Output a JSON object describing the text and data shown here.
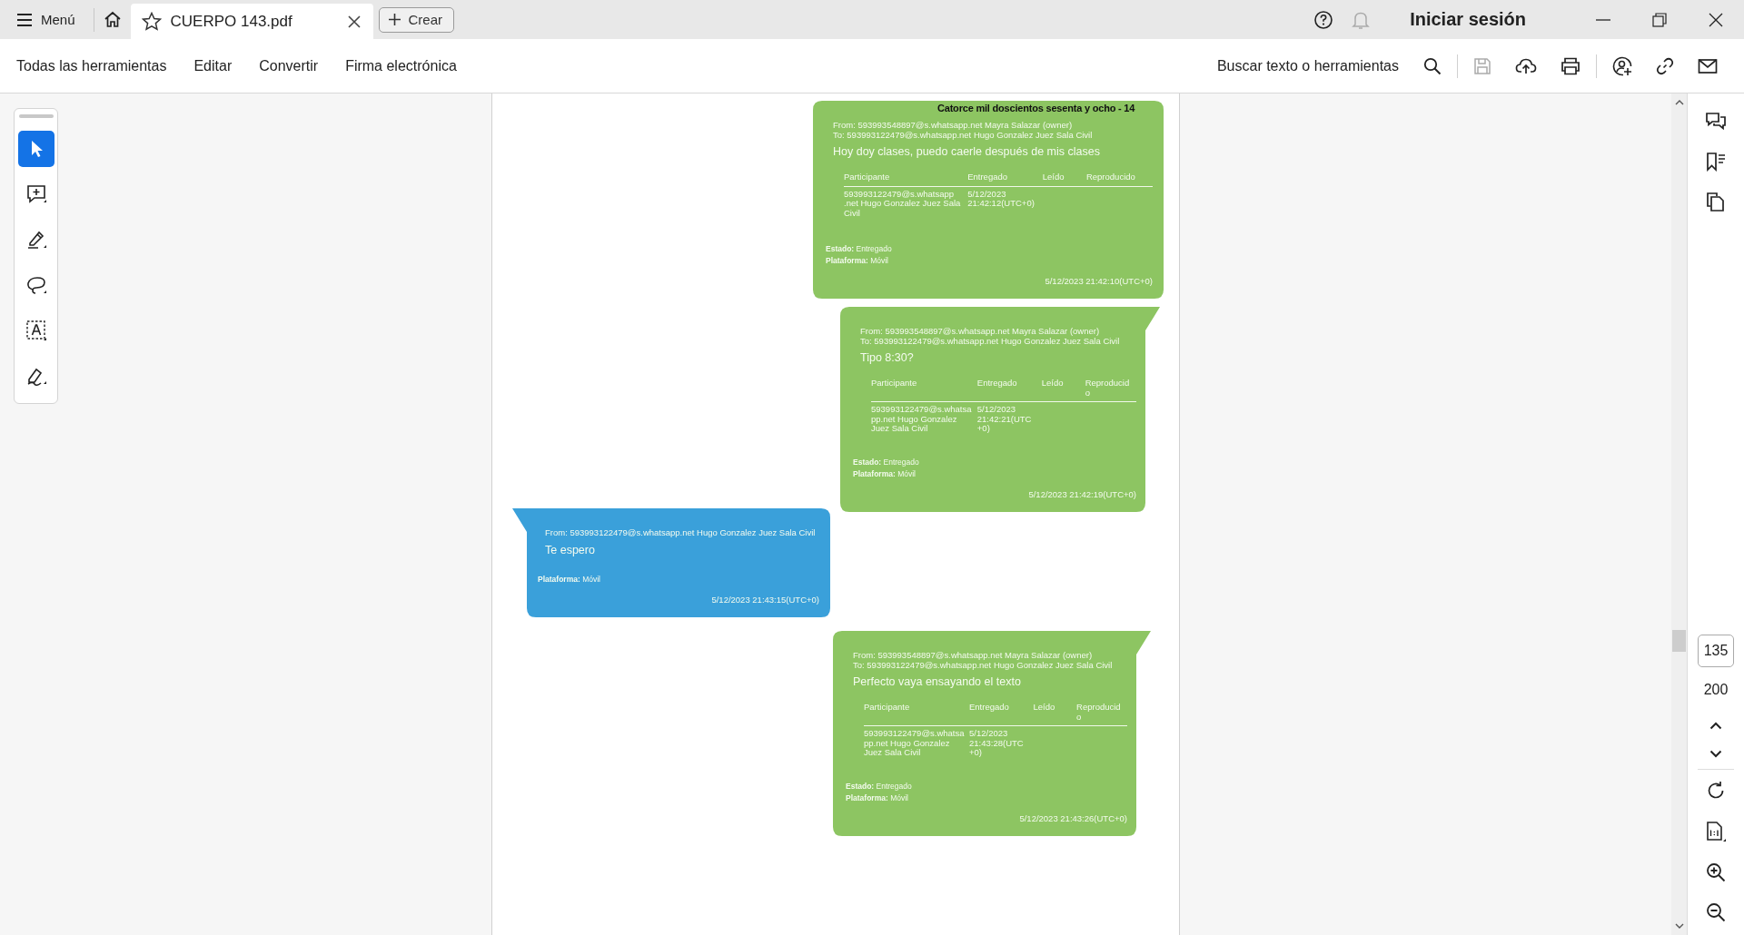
{
  "title_bar": {
    "menu": "Menú",
    "tab": {
      "title": "CUERPO 143.pdf"
    },
    "create": "Crear",
    "sign_in": "Iniciar sesión"
  },
  "toolbar": {
    "items": [
      "Todas las herramientas",
      "Editar",
      "Convertir",
      "Firma electrónica"
    ],
    "search": "Buscar texto o herramientas"
  },
  "tools": [
    {
      "kind": "select",
      "selected": true
    },
    {
      "kind": "comment",
      "selected": false
    },
    {
      "kind": "highlight",
      "selected": false
    },
    {
      "kind": "lasso",
      "selected": false
    },
    {
      "kind": "text",
      "selected": false
    },
    {
      "kind": "sign",
      "selected": false
    }
  ],
  "document": {
    "caption": "Catorce mil doscientos sesenta y ocho - 14",
    "messages": [
      {
        "kind": "sent",
        "from": "From: 593993548897@s.whatsapp.net Mayra Salazar (owner)",
        "to": "To: 593993122479@s.whatsapp.net Hugo Gonzalez Juez Sala Civil",
        "body": "Hoy doy clases, puedo caerle después de mis clases",
        "columns": [
          "Participante",
          "Entregado",
          "Leído",
          "Reproducido"
        ],
        "rows": [
          [
            "593993122479@s.whatsapp .net Hugo Gonzalez Juez Sala Civil",
            "5/12/2023 21:42:12(UTC+0)"
          ]
        ],
        "status": "**Estado:** Entregado",
        "platform": "**Plataforma:** Móvil",
        "time": "5/12/2023 21:42:10(UTC+0)"
      },
      {
        "kind": "sent",
        "from": "From: 593993548897@s.whatsapp.net Mayra Salazar (owner)",
        "to": "To: 593993122479@s.whatsapp.net Hugo Gonzalez Juez Sala Civil",
        "body": "Tipo 8:30?",
        "columns": [
          "Participante",
          "Entregado",
          "Leído",
          "Reproducido"
        ],
        "rows": [
          [
            "593993122479@s.whatsapp.net Hugo Gonzalez Juez Sala Civil",
            "5/12/2023 21:42:21(UTC +0)"
          ]
        ],
        "status": "**Estado:** Entregado",
        "platform": "**Plataforma:** Móvil",
        "time": "5/12/2023 21:42:19(UTC+0)"
      },
      {
        "kind": "received",
        "from": "From: 593993122479@s.whatsapp.net Hugo Gonzalez Juez Sala Civil",
        "body": "Te espero",
        "platform": "**Plataforma:** Móvil",
        "time": "5/12/2023 21:43:15(UTC+0)"
      },
      {
        "kind": "sent",
        "from": "From: 593993548897@s.whatsapp.net Mayra Salazar (owner)",
        "to": "To: 593993122479@s.whatsapp.net Hugo Gonzalez Juez Sala Civil",
        "body": "Perfecto vaya ensayando el texto",
        "columns": [
          "Participante",
          "Entregado",
          "Leído",
          "Reproducido"
        ],
        "rows": [
          [
            "593993122479@s.whatsapp.net Hugo Gonzalez Juez Sala Civil",
            "5/12/2023 21:43:28(UTC +0)"
          ]
        ],
        "status": "**Estado:** Entregado",
        "platform": "**Plataforma:** Móvil",
        "time": "5/12/2023 21:43:26(UTC+0)"
      }
    ]
  },
  "page_nav": {
    "current": "135",
    "total": "200"
  }
}
